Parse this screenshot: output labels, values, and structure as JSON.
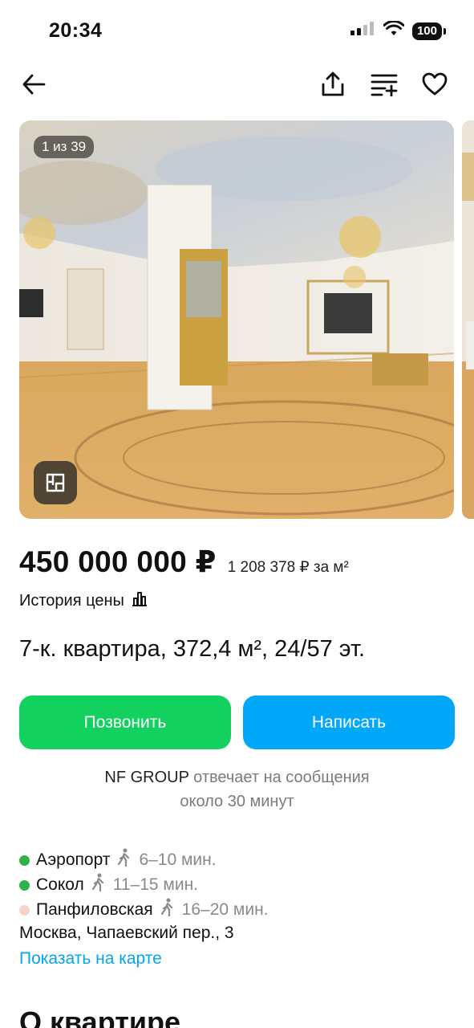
{
  "status_bar": {
    "time": "20:34",
    "battery": "100"
  },
  "toolbar": {
    "icons": [
      "back-arrow-icon",
      "share-icon",
      "compare-icon",
      "heart-icon"
    ]
  },
  "gallery": {
    "counter": "1 из 39",
    "plan_icon": "floor-plan-icon"
  },
  "listing": {
    "price": "450 000 000 ₽",
    "price_per_m2": "1 208 378 ₽ за м²",
    "price_history": "История цены",
    "title": "7-к. квартира, 372,4 м², 24/57 эт."
  },
  "actions": {
    "call_label": "Позвонить",
    "write_label": "Написать",
    "call_color": "#12d15e",
    "write_color": "#01a7f9"
  },
  "reply_info": {
    "seller": "NF GROUP",
    "text": "отвечает на сообщения",
    "time": "около 30 минут"
  },
  "metro": [
    {
      "station": "Аэропорт",
      "time": "6–10 мин.",
      "color": "#2db34a"
    },
    {
      "station": "Сокол",
      "time": "11–15 мин.",
      "color": "#2db34a"
    },
    {
      "station": "Панфиловская",
      "time": "16–20 мин.",
      "color": "#f6d3c9"
    }
  ],
  "address": "Москва, Чапаевский пер., 3",
  "map_link": "Показать на карте",
  "section_title": "О квартире"
}
